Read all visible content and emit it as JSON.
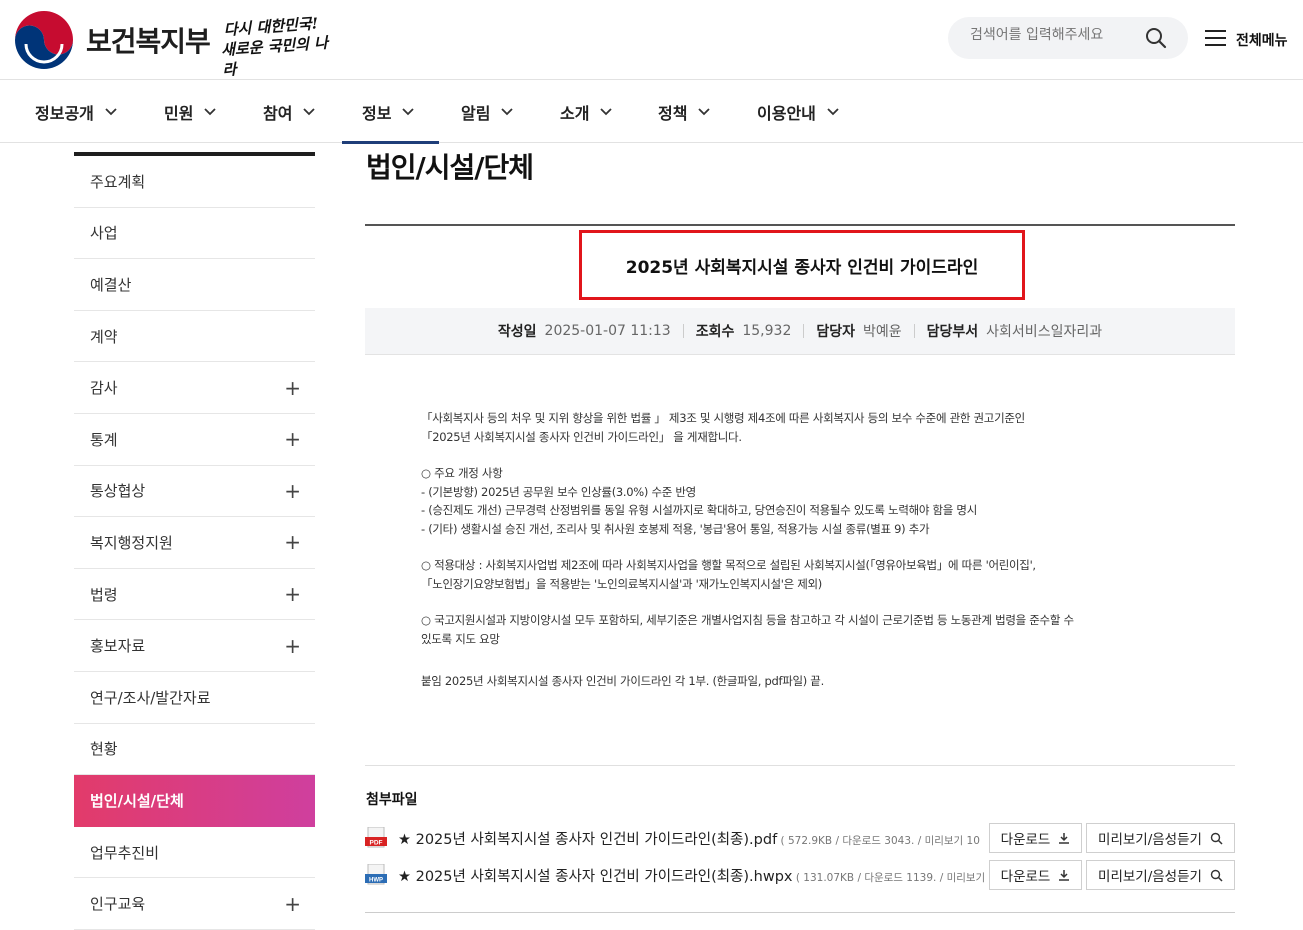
{
  "header": {
    "logo_text": "보건복지부",
    "slogan": [
      "다시 대한민국!",
      "새로운 국민의 나라"
    ],
    "search_placeholder": "검색어를 입력해주세요",
    "all_menu_label": "전체메뉴"
  },
  "nav": {
    "items": [
      {
        "label": "정보공개",
        "active": false
      },
      {
        "label": "민원",
        "active": false
      },
      {
        "label": "참여",
        "active": false
      },
      {
        "label": "정보",
        "active": true
      },
      {
        "label": "알림",
        "active": false
      },
      {
        "label": "소개",
        "active": false
      },
      {
        "label": "정책",
        "active": false
      },
      {
        "label": "이용안내",
        "active": false
      }
    ]
  },
  "sidebar": {
    "items": [
      {
        "label": "주요계획",
        "expandable": false
      },
      {
        "label": "사업",
        "expandable": false
      },
      {
        "label": "예결산",
        "expandable": false
      },
      {
        "label": "계약",
        "expandable": false
      },
      {
        "label": "감사",
        "expandable": true
      },
      {
        "label": "통계",
        "expandable": true
      },
      {
        "label": "통상협상",
        "expandable": true
      },
      {
        "label": "복지행정지원",
        "expandable": true
      },
      {
        "label": "법령",
        "expandable": true
      },
      {
        "label": "홍보자료",
        "expandable": true
      },
      {
        "label": "연구/조사/발간자료",
        "expandable": false
      },
      {
        "label": "현황",
        "expandable": false
      },
      {
        "label": "법인/시설/단체",
        "expandable": false,
        "active": true
      },
      {
        "label": "업무추진비",
        "expandable": false
      },
      {
        "label": "인구교육",
        "expandable": true
      }
    ],
    "plus_symbol": "+"
  },
  "main": {
    "page_title": "법인/시설/단체",
    "post_title": "2025년 사회복지시설 종사자 인건비 가이드라인",
    "meta": {
      "date_label": "작성일",
      "date_value": "2025-01-07 11:13",
      "views_label": "조회수",
      "views_value": "15,932",
      "manager_label": "담당자",
      "manager_value": "박예윤",
      "dept_label": "담당부서",
      "dept_value": "사회서비스일자리과"
    },
    "body": [
      "「사회복지사 등의 처우 및 지위 향상을 위한 법률 」 제3조 및 시행령 제4조에 따른 사회복지사 등의 보수 수준에 관한 권고기준인",
      "「2025년  사회복지시설 종사자 인건비 가이드라인」 을 게재합니다.",
      "○  주요 개정 사항",
      " - (기본방향) 2025년 공무원 보수 인상률(3.0%) 수준 반영",
      " - (승진제도 개선) 근무경력 산정범위를 동일 유형 시설까지로 확대하고, 당연승진이 적용될수 있도록 노력해야 함을 명시",
      " - (기타) 생활시설 승진 개선, 조리사 및 취사원 호봉제 적용,  '봉급'용어 통일, 적용가능 시설 종류(별표 9) 추가",
      "○  적용대상 :  사회복지사업법 제2조에 따라 사회복지사업을 행할 목적으로 설립된 사회복지시설(「영유아보육법」에 따른 '어린이집',",
      "      「노인장기요양보험법」을 적용받는 '노인의료복지시설'과 '재가노인복지시설'은 제외)",
      "○  국고지원시설과 지방이양시설 모두 포함하되, 세부기준은 개별사업지침 등을 참고하고 각 시설이 근로기준법 등 노동관계 법령을 준수할 수",
      "     있도록 지도 요망",
      "붙임   2025년 사회복지시설 종사자 인건비 가이드라인 각 1부. (한글파일, pdf파일)   끝."
    ],
    "attachments_title": "첨부파일",
    "files": [
      {
        "type": "PDF",
        "name": "★ 2025년 사회복지시설 종사자 인건비 가이드라인(최종).pdf",
        "meta": " ( 572.9KB / 다운로드 3043. / 미리보기 10"
      },
      {
        "type": "HWP",
        "name": "★ 2025년 사회복지시설 종사자 인건비 가이드라인(최종).hwpx",
        "meta": " ( 131.07KB / 다운로드 1139. / 미리보기"
      }
    ],
    "download_label": "다운로드",
    "preview_label": "미리보기/음성듣기"
  },
  "colors": {
    "accent_navy": "#1f3e79",
    "highlight_red": "#e1151b",
    "sidebar_active_start": "#e23b6a",
    "sidebar_active_end": "#cf3f9e"
  }
}
